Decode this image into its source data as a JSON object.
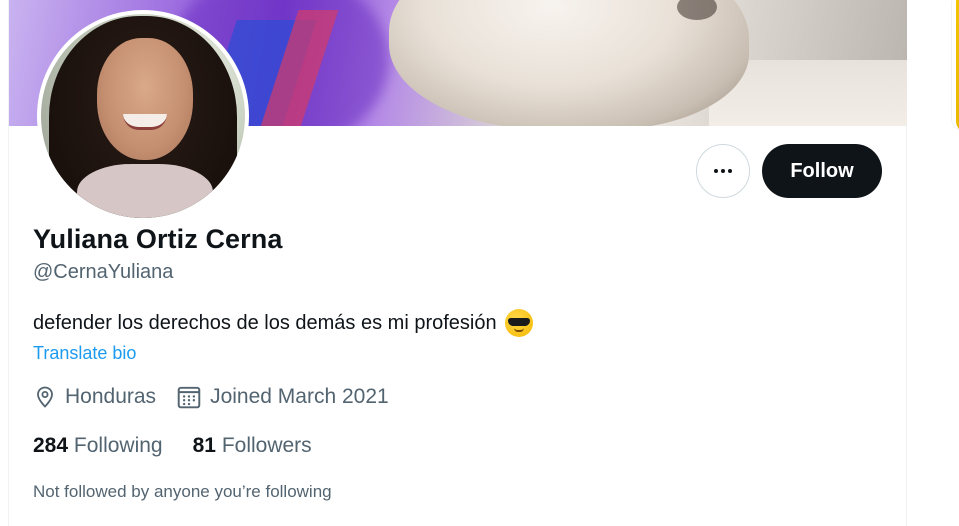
{
  "profile": {
    "display_name": "Yuliana Ortiz Cerna",
    "handle": "@CernaYuliana",
    "bio": "defender los derechos de los demás es mi profesión",
    "bio_emoji": "smiling-face-with-sunglasses",
    "translate_bio": "Translate bio",
    "location": "Honduras",
    "joined": "Joined March 2021",
    "following_count": "284",
    "following_label": "Following",
    "followers_count": "81",
    "followers_label": "Followers",
    "mutuals_note": "Not followed by anyone you’re following"
  },
  "actions": {
    "more_icon": "more-horizontal-icon",
    "follow_label": "Follow"
  },
  "icons": {
    "location": "location-pin-icon",
    "calendar": "calendar-icon"
  },
  "colors": {
    "link": "#1d9bf0",
    "secondary_text": "#536471",
    "primary_text": "#0f1419",
    "follow_button_bg": "#0f1419"
  }
}
